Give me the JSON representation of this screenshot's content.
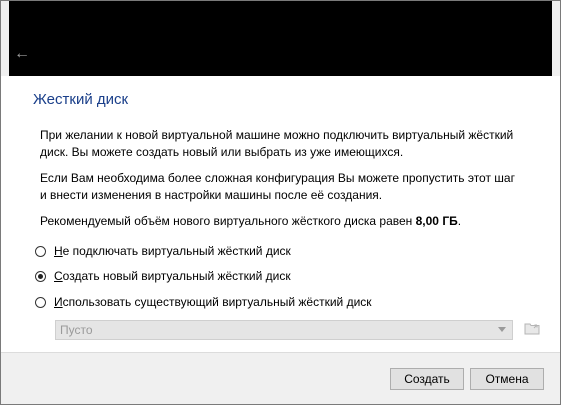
{
  "header": {
    "back_icon": "back-arrow-icon"
  },
  "page": {
    "title": "Жесткий диск",
    "para1": "При желании к новой виртуальной машине можно подключить виртуальный жёсткий диск. Вы можете создать новый или выбрать из уже имеющихся.",
    "para2": "Если Вам необходима более сложная конфигурация Вы можете пропустить этот шаг и внести изменения в настройки машины после её создания.",
    "para3_prefix": "Рекомендуемый объём нового виртуального жёсткого диска равен ",
    "para3_size": "8,00 ГБ",
    "para3_suffix": "."
  },
  "options": {
    "no_disk": "Не подключать виртуальный жёсткий диск",
    "create_new": "Создать новый виртуальный жёсткий диск",
    "use_existing": "Использовать существующий виртуальный жёсткий диск",
    "selected": "create_new"
  },
  "existing_disk": {
    "value": "Пусто",
    "folder_icon": "folder-icon"
  },
  "buttons": {
    "create": "Создать",
    "cancel": "Отмена"
  }
}
